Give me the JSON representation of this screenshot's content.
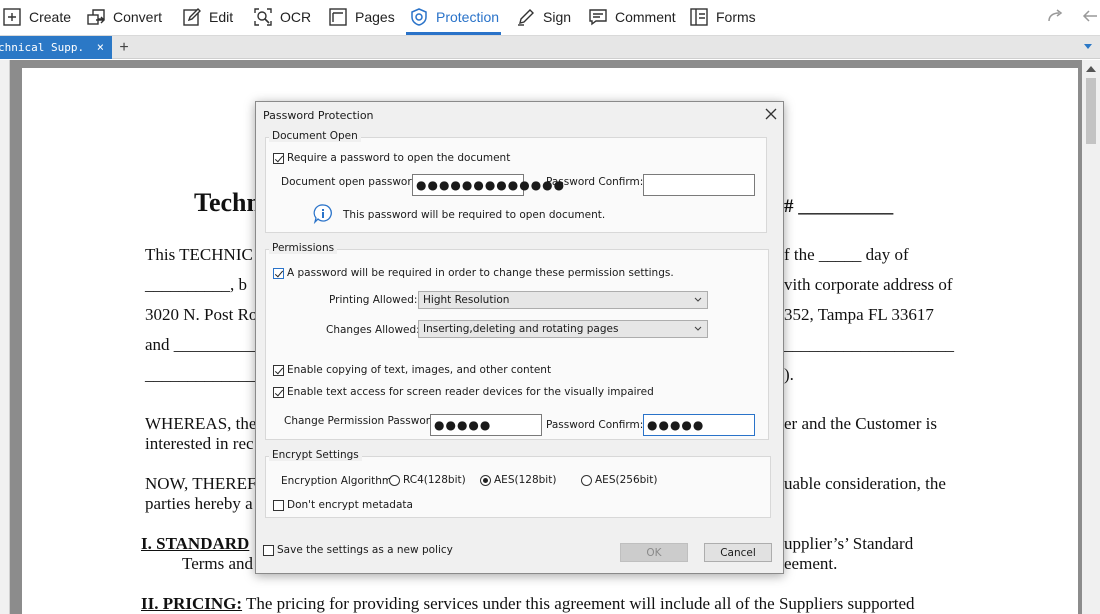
{
  "toolbar": {
    "items": [
      {
        "label": "Create",
        "icon": "plus-box-icon"
      },
      {
        "label": "Convert",
        "icon": "convert-icon"
      },
      {
        "label": "Edit",
        "icon": "edit-icon"
      },
      {
        "label": "OCR",
        "icon": "ocr-icon"
      },
      {
        "label": "Pages",
        "icon": "pages-icon"
      },
      {
        "label": "Protection",
        "icon": "shield-icon",
        "active": true
      },
      {
        "label": "Sign",
        "icon": "pen-icon"
      },
      {
        "label": "Comment",
        "icon": "comment-icon"
      },
      {
        "label": "Forms",
        "icon": "forms-icon"
      }
    ],
    "accent": "#2a73c9"
  },
  "tabs": {
    "active_title": "chnical Supp...",
    "close": "×",
    "add": "+"
  },
  "document": {
    "title_fragment": "Techn",
    "hash_fragment": "# __________",
    "lines": [
      {
        "left": "This TECHNIC",
        "right": "f the _____ day of"
      },
      {
        "left": "__________, b",
        "right": "vith corporate address of"
      },
      {
        "left": "3020 N. Post Ro",
        "right": "352, Tampa FL 33617"
      },
      {
        "left": "and ___________",
        "right": "____________________"
      },
      {
        "left": "_____________",
        "right": ")."
      },
      {
        "left": "WHEREAS, the",
        "right": "er and the Customer is"
      },
      {
        "left": "interested in rec",
        "right": ""
      },
      {
        "left": "NOW, THEREF",
        "right": "uable consideration, the"
      },
      {
        "left": "parties hereby a",
        "right": ""
      },
      {
        "left": "I. STANDARD",
        "right": "upplier’s’ Standard"
      },
      {
        "left": "Terms and",
        "right": "eement."
      }
    ],
    "pricing_heading": "II. PRICING:",
    "pricing_text": " The pricing for providing services under this agreement will include all of the Suppliers supported"
  },
  "dialog": {
    "title": "Password Protection",
    "document_open": {
      "group_label": "Document Open",
      "require_label": "Require a password to open the document",
      "require_checked": true,
      "open_password_label": "Document open password:",
      "open_password_value": "●●●●●●●●●●●●●",
      "confirm_label": "Password Confirm:",
      "confirm_value": "",
      "info_text": "This password will be required to open document."
    },
    "permissions": {
      "group_label": "Permissions",
      "require_label": "A password will be required in order to change these permission settings.",
      "require_checked": true,
      "printing_label": "Printing Allowed:",
      "printing_value": "Hight Resolution",
      "changes_label": "Changes Allowed:",
      "changes_value": "Inserting,deleting and rotating pages",
      "copy_label": "Enable copying of text, images, and other content",
      "copy_checked": true,
      "reader_label": "Enable text access for screen reader devices for the visually impaired",
      "reader_checked": true,
      "perm_password_label": "Change Permission Password:",
      "perm_password_value": "●●●●●",
      "perm_confirm_label": "Password Confirm:",
      "perm_confirm_value": "●●●●●"
    },
    "encrypt": {
      "group_label": "Encrypt Settings",
      "algorithm_label": "Encryption Algorithm:",
      "options": [
        "RC4(128bit)",
        "AES(128bit)",
        "AES(256bit)"
      ],
      "selected": "AES(128bit)",
      "metadata_label": "Don't encrypt metadata",
      "metadata_checked": false
    },
    "save_settings_label": "Save the settings as a new policy",
    "save_settings_checked": false,
    "ok_label": "OK",
    "cancel_label": "Cancel"
  }
}
